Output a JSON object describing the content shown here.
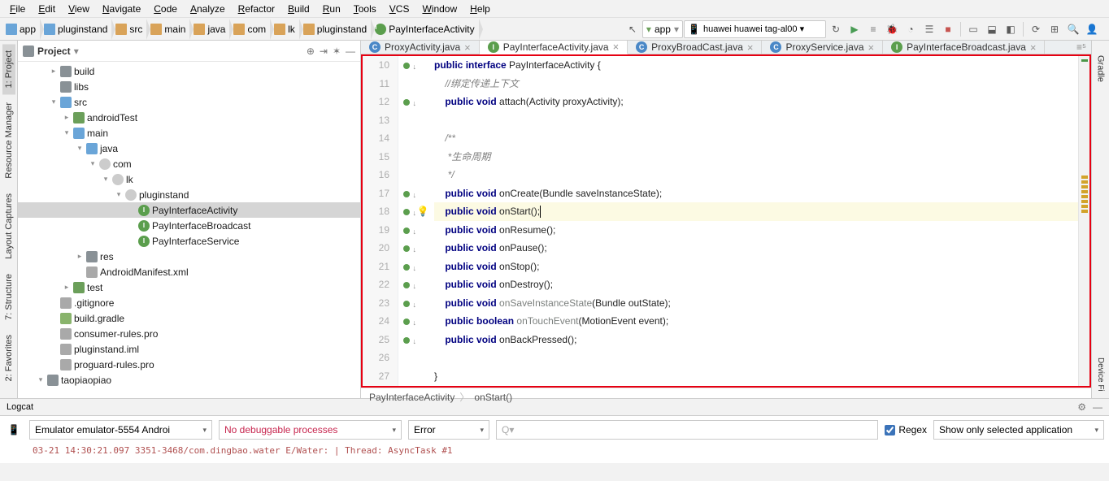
{
  "menu": [
    "File",
    "Edit",
    "View",
    "Navigate",
    "Code",
    "Analyze",
    "Refactor",
    "Build",
    "Run",
    "Tools",
    "VCS",
    "Window",
    "Help"
  ],
  "crumbs": [
    {
      "icon": "mod",
      "label": "app"
    },
    {
      "icon": "mod",
      "label": "pluginstand"
    },
    {
      "icon": "folder",
      "label": "src"
    },
    {
      "icon": "folder",
      "label": "main"
    },
    {
      "icon": "folder",
      "label": "java"
    },
    {
      "icon": "folder",
      "label": "com"
    },
    {
      "icon": "folder",
      "label": "lk"
    },
    {
      "icon": "folder",
      "label": "pluginstand"
    },
    {
      "icon": "iface",
      "label": "PayInterfaceActivity"
    }
  ],
  "runConfig": {
    "module": "app",
    "device": "huawei huawei tag-al00  ▾"
  },
  "project": {
    "title": "Project",
    "tree": [
      {
        "d": 2,
        "tw": "▸",
        "i": "folder",
        "l": "build"
      },
      {
        "d": 2,
        "tw": "",
        "i": "folder",
        "l": "libs"
      },
      {
        "d": 2,
        "tw": "▾",
        "i": "folder src",
        "l": "src"
      },
      {
        "d": 3,
        "tw": "▸",
        "i": "folder test",
        "l": "androidTest"
      },
      {
        "d": 3,
        "tw": "▾",
        "i": "folder src",
        "l": "main"
      },
      {
        "d": 4,
        "tw": "▾",
        "i": "folder src",
        "l": "java"
      },
      {
        "d": 5,
        "tw": "▾",
        "i": "pkg",
        "l": "com"
      },
      {
        "d": 6,
        "tw": "▾",
        "i": "pkg",
        "l": "lk"
      },
      {
        "d": 7,
        "tw": "▾",
        "i": "pkg",
        "l": "pluginstand"
      },
      {
        "d": 8,
        "tw": "",
        "i": "iface",
        "l": "PayInterfaceActivity",
        "sel": true
      },
      {
        "d": 8,
        "tw": "",
        "i": "iface",
        "l": "PayInterfaceBroadcast"
      },
      {
        "d": 8,
        "tw": "",
        "i": "iface",
        "l": "PayInterfaceService"
      },
      {
        "d": 4,
        "tw": "▸",
        "i": "folder",
        "l": "res"
      },
      {
        "d": 4,
        "tw": "",
        "i": "file",
        "l": "AndroidManifest.xml"
      },
      {
        "d": 3,
        "tw": "▸",
        "i": "folder test",
        "l": "test"
      },
      {
        "d": 2,
        "tw": "",
        "i": "file",
        "l": ".gitignore"
      },
      {
        "d": 2,
        "tw": "",
        "i": "gradle",
        "l": "build.gradle"
      },
      {
        "d": 2,
        "tw": "",
        "i": "file",
        "l": "consumer-rules.pro"
      },
      {
        "d": 2,
        "tw": "",
        "i": "file",
        "l": "pluginstand.iml"
      },
      {
        "d": 2,
        "tw": "",
        "i": "file",
        "l": "proguard-rules.pro"
      },
      {
        "d": 1,
        "tw": "▾",
        "i": "folder",
        "l": "taopiaopiao"
      }
    ]
  },
  "tabs": [
    {
      "icon": "C",
      "label": "ProxyActivity.java"
    },
    {
      "icon": "I",
      "label": "PayInterfaceActivity.java",
      "active": true
    },
    {
      "icon": "C",
      "label": "ProxyBroadCast.java"
    },
    {
      "icon": "C",
      "label": "ProxyService.java"
    },
    {
      "icon": "I",
      "label": "PayInterfaceBroadcast.java"
    }
  ],
  "code": {
    "startLine": 10,
    "lines": [
      {
        "m": 1,
        "html": "<span class='kw'>public</span> <span class='kw'>interface</span> PayInterfaceActivity {"
      },
      {
        "html": "    <span class='cm'>//绑定传递上下文</span>"
      },
      {
        "m": 1,
        "html": "    <span class='kw'>public</span> <span class='kw'>void</span> attach(Activity proxyActivity);"
      },
      {
        "html": ""
      },
      {
        "html": "    <span class='cm'>/**</span>"
      },
      {
        "html": "    <span class='cm'> *生命周期</span>"
      },
      {
        "html": "    <span class='cm'> */</span>"
      },
      {
        "m": 1,
        "html": "    <span class='kw'>public</span> <span class='kw'>void</span> onCreate(Bundle saveInstanceState);"
      },
      {
        "m": 1,
        "hl": true,
        "bulb": true,
        "html": "    <span class='kw'>public</span> <span class='kw'>void</span> onStart();<span class='caret'></span>"
      },
      {
        "m": 1,
        "html": "    <span class='kw'>public</span> <span class='kw'>void</span> onResume();"
      },
      {
        "m": 1,
        "html": "    <span class='kw'>public</span> <span class='kw'>void</span> onPause();"
      },
      {
        "m": 1,
        "html": "    <span class='kw'>public</span> <span class='kw'>void</span> onStop();"
      },
      {
        "m": 1,
        "html": "    <span class='kw'>public</span> <span class='kw'>void</span> onDestroy();"
      },
      {
        "m": 1,
        "html": "    <span class='kw'>public</span> <span class='kw'>void</span> <span class='ann'>onSaveInstanceState</span>(Bundle outState);"
      },
      {
        "m": 1,
        "html": "    <span class='kw'>public</span> <span class='kw'>boolean</span> <span class='ann'>onTouchEvent</span>(MotionEvent event);"
      },
      {
        "m": 1,
        "html": "    <span class='kw'>public</span> <span class='kw'>void</span> onBackPressed();"
      },
      {
        "html": ""
      },
      {
        "html": "}"
      }
    ],
    "breadcrumb": [
      "PayInterfaceActivity",
      "onStart()"
    ]
  },
  "logcat": {
    "title": "Logcat",
    "device": "Emulator emulator-5554 Androi",
    "process": "No debuggable processes",
    "level": "Error",
    "searchPlaceholder": "Q▾",
    "regex": "Regex",
    "filter": "Show only selected application",
    "out": "03-21 14:30:21.097 3351-3468/com.dingbao.water E/Water:  | Thread: AsyncTask #1"
  },
  "leftRail": [
    {
      "l": "1: Project",
      "a": true
    },
    {
      "l": "Resource Manager"
    },
    {
      "l": "Layout Captures"
    },
    {
      "l": "7: Structure"
    },
    {
      "l": "2: Favorites"
    }
  ]
}
